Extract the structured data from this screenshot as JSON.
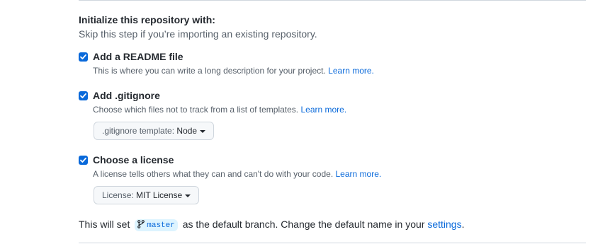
{
  "section": {
    "title": "Initialize this repository with:",
    "description": "Skip this step if you’re importing an existing repository."
  },
  "options": [
    {
      "label": "Add a README file",
      "checked": true,
      "note": "This is where you can write a long description for your project.",
      "link": "Learn more."
    },
    {
      "label": "Add .gitignore",
      "checked": true,
      "note": "Choose which files not to track from a list of templates.",
      "link": "Learn more.",
      "dropdown": {
        "prefix": ".gitignore template:",
        "value": "Node"
      }
    },
    {
      "label": "Choose a license",
      "checked": true,
      "note": "A license tells others what they can and can't do with your code.",
      "link": "Learn more.",
      "dropdown": {
        "prefix": "License:",
        "value": "MIT License"
      }
    }
  ],
  "footer": {
    "before": "This will set",
    "branch": "master",
    "after": "as the default branch. Change the default name in your",
    "link": "settings",
    "end": "."
  },
  "colors": {
    "accent": "#0969da",
    "text": "#24292f",
    "muted": "#57606a",
    "border": "#d0d7de"
  },
  "icons": {
    "checkbox": "checkmark-icon",
    "branch": "git-branch-icon",
    "dropdown": "caret-down-icon"
  }
}
